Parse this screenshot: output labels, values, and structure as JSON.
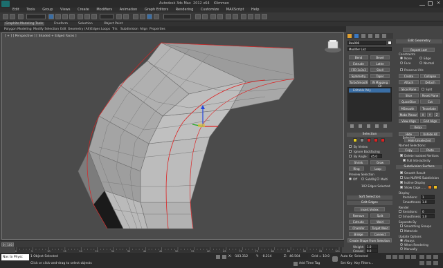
{
  "app": {
    "title": "Autodesk 3ds Max  2012 x64    Klimmen"
  },
  "menus": [
    "Edit",
    "Tools",
    "Group",
    "Views",
    "Create",
    "Modifiers",
    "Animation",
    "Graph Editors",
    "Rendering",
    "Customize",
    "MAXScript",
    "Help"
  ],
  "ribbon": {
    "tabs": [
      "Graphite Modeling Tools",
      "Freeform",
      "Selection",
      "Object Paint"
    ],
    "row": [
      "Polygon Modeling",
      "Modify Selection",
      "Edit",
      "Geometry (All)",
      "Edges",
      "Loops",
      "Tris",
      "Subdivision",
      "Align",
      "Properties"
    ]
  },
  "viewport": {
    "label": "[ + ] [ Perspective ] [ Shaded + Edged Faces ]"
  },
  "timeline": {
    "frame": "0 / 100"
  },
  "ruler": [
    "0",
    "5",
    "10",
    "15",
    "20",
    "25",
    "30",
    "35",
    "40",
    "45",
    "50",
    "55",
    "60",
    "65",
    "70",
    "75",
    "80",
    "85",
    "90",
    "95",
    "100"
  ],
  "status": {
    "maxscript": "Nas to Physc",
    "selected": "1 Object Selected",
    "hint": "Click or click-and-drag to select objects",
    "x_label": "X:",
    "x_value": "-103.312",
    "y_label": "Y:",
    "y_value": "-8.214",
    "z_label": "Z:",
    "z_value": "46.504",
    "grid": "Grid = 10.0",
    "add_time_tag": "Add Time Tag",
    "autokey": "Auto Key",
    "autokey_value": "Selected",
    "setkey": "Set Key",
    "key_filters": "Key Filters..."
  },
  "cmd": {
    "object_name": "Box006",
    "modifier_list": "Modifier List",
    "buttons": [
      [
        "Bend",
        "Bevel"
      ],
      [
        "Extrude",
        "Lathe"
      ],
      [
        "FFD 3x3x3",
        "Shell"
      ],
      [
        "Symmetry",
        "Taper"
      ],
      [
        "TurboSmooth",
        "W Mapping Clr"
      ]
    ],
    "stack_item": "Editable Poly",
    "selection": {
      "title": "Selection",
      "by_vertex": "By Vertex",
      "ignore_backfacing": "Ignore Backfacing",
      "by_angle": "By Angle:",
      "by_angle_value": "45.0",
      "shrink": "Shrink",
      "grow": "Grow",
      "ring": "Ring",
      "loop": "Loop",
      "preview": "Preview Selection",
      "off": "Off",
      "subobj": "SubObj",
      "multi": "Multi",
      "status": "102 Edges Selected"
    },
    "soft_selection": "Soft Selection",
    "edit_edges": {
      "title": "Edit Edges",
      "insert_vertex": "Insert Vertex",
      "remove": "Remove",
      "split": "Split",
      "extrude": "Extrude",
      "weld": "Weld",
      "chamfer": "Chamfer",
      "target_weld": "Target Weld",
      "bridge": "Bridge",
      "connect": "Connect",
      "create_shape": "Create Shape From Selection",
      "weight": "Weight:",
      "weight_value": "1.0",
      "crease": "Crease:",
      "crease_value": "0.0"
    }
  },
  "geom": {
    "title": "Edit Geometry",
    "repeat_last": "Repeat Last",
    "constraints": "Constraints",
    "none": "None",
    "edge": "Edge",
    "face": "Face",
    "normal": "Normal",
    "preserve_uvs": "Preserve UVs",
    "create": "Create",
    "collapse": "Collapse",
    "attach": "Attach",
    "detach": "Detach",
    "slice_plane": "Slice Plane",
    "split": "Split",
    "slice": "Slice",
    "reset_plane": "Reset Plane",
    "quickslice": "QuickSlice",
    "cut": "Cut",
    "msmooth": "MSmooth",
    "tessellate": "Tessellate",
    "make_planar": "Make Planar",
    "x": "X",
    "y": "Y",
    "z": "Z",
    "view_align": "View Align",
    "grid_align": "Grid Align",
    "relax": "Relax",
    "hide_selected": "Hide Selected",
    "unhide_all": "Unhide All",
    "hide_unselected": "Hide Unselected",
    "named_selections": "Named Selections:",
    "copy": "Copy",
    "paste": "Paste",
    "delete_isolated": "Delete Isolated Vertices",
    "full_interactivity": "Full Interactivity"
  },
  "subdiv": {
    "title": "Subdivision Surface",
    "smooth_result": "Smooth Result",
    "use_nurms": "Use NURMS Subdivision",
    "isoline": "Isoline Display",
    "show_cage": "Show Cage......",
    "display": "Display",
    "iterations": "Iterations:",
    "iterations_value": "1",
    "smoothness": "Smoothness:",
    "smoothness_value": "1.0",
    "render": "Render",
    "r_iterations": "Iterations:",
    "r_iterations_value": "0",
    "r_smoothness": "Smoothness:",
    "r_smoothness_value": "1.0",
    "separate_by": "Separate By",
    "smoothing_groups": "Smoothing Groups",
    "materials": "Materials",
    "update_options": "Update Options",
    "always": "Always",
    "when_rendering": "When Rendering",
    "manually": "Manually"
  },
  "colors": {
    "cage1": "#e07820",
    "cage2": "#f0c020",
    "viewport_bg": "#4b4b4b",
    "selected_edges": "#dd2222"
  }
}
